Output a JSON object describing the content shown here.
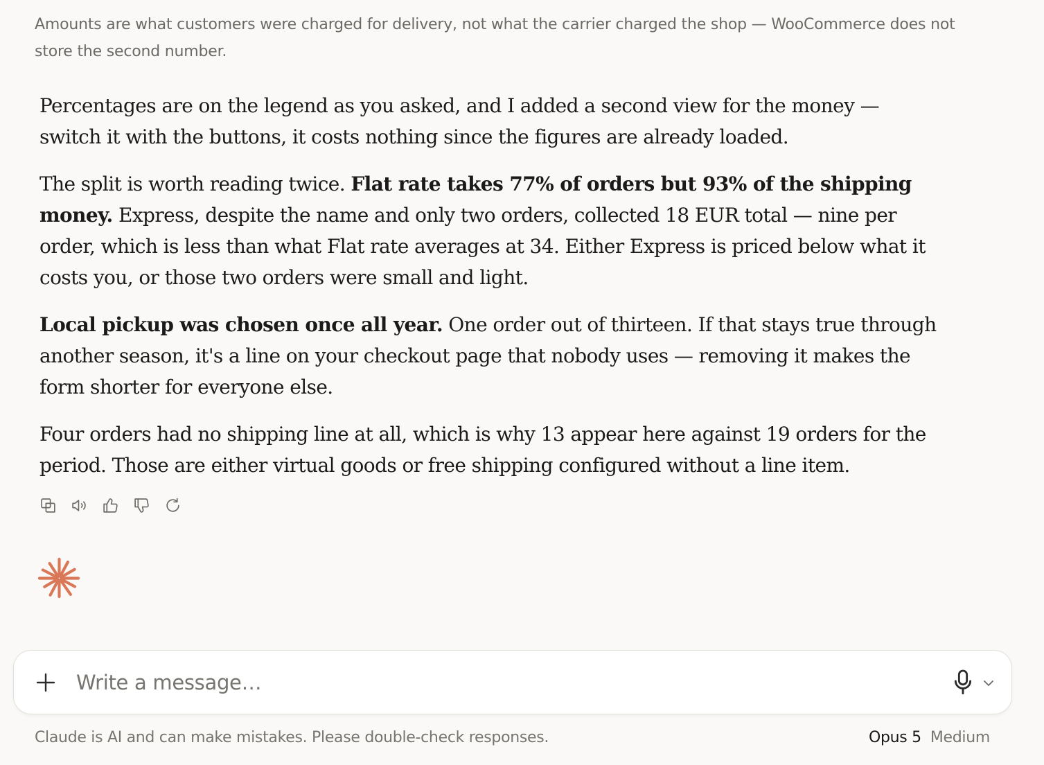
{
  "note": {
    "text": "Amounts are what customers were charged for delivery, not what the carrier charged the shop — WooCommerce does not store the second number."
  },
  "answer": {
    "p1": "Percentages are on the legend as you asked, and I added a second view for the money — switch it with the buttons, it costs nothing since the figures are already loaded.",
    "p2_lead": "The split is worth reading twice.",
    "p2_bold": "Flat rate takes 77% of orders but 93% of the shipping money.",
    "p2_rest": "Express, despite the name and only two orders, collected 18 EUR total — nine per order, which is less than what Flat rate averages at 34. Either Express is priced below what it costs you, or those two orders were small and light.",
    "p3_bold": "Local pickup was chosen once all year.",
    "p3_rest": "One order out of thirteen. If that stays true through another season, it's a line on your checkout page that nobody uses — removing it makes the form shorter for everyone else.",
    "p4": "Four orders had no shipping line at all, which is why 13 appear here against 19 orders for the period. Those are either virtual goods or free shipping configured without a line item."
  },
  "actions": {
    "icons": [
      "copy-icon",
      "speaker-icon",
      "thumbs-up-icon",
      "thumbs-down-icon",
      "retry-icon"
    ]
  },
  "composer": {
    "placeholder": "Write a message…",
    "value": ""
  },
  "footer": {
    "disclaimer": "Claude is AI and can make mistakes. Please double-check responses.",
    "model_name": "Opus 5",
    "model_effort": "Medium"
  },
  "colors": {
    "background": "#faf9f7",
    "accent": "#d97757",
    "muted_text": "#6b6a66"
  }
}
